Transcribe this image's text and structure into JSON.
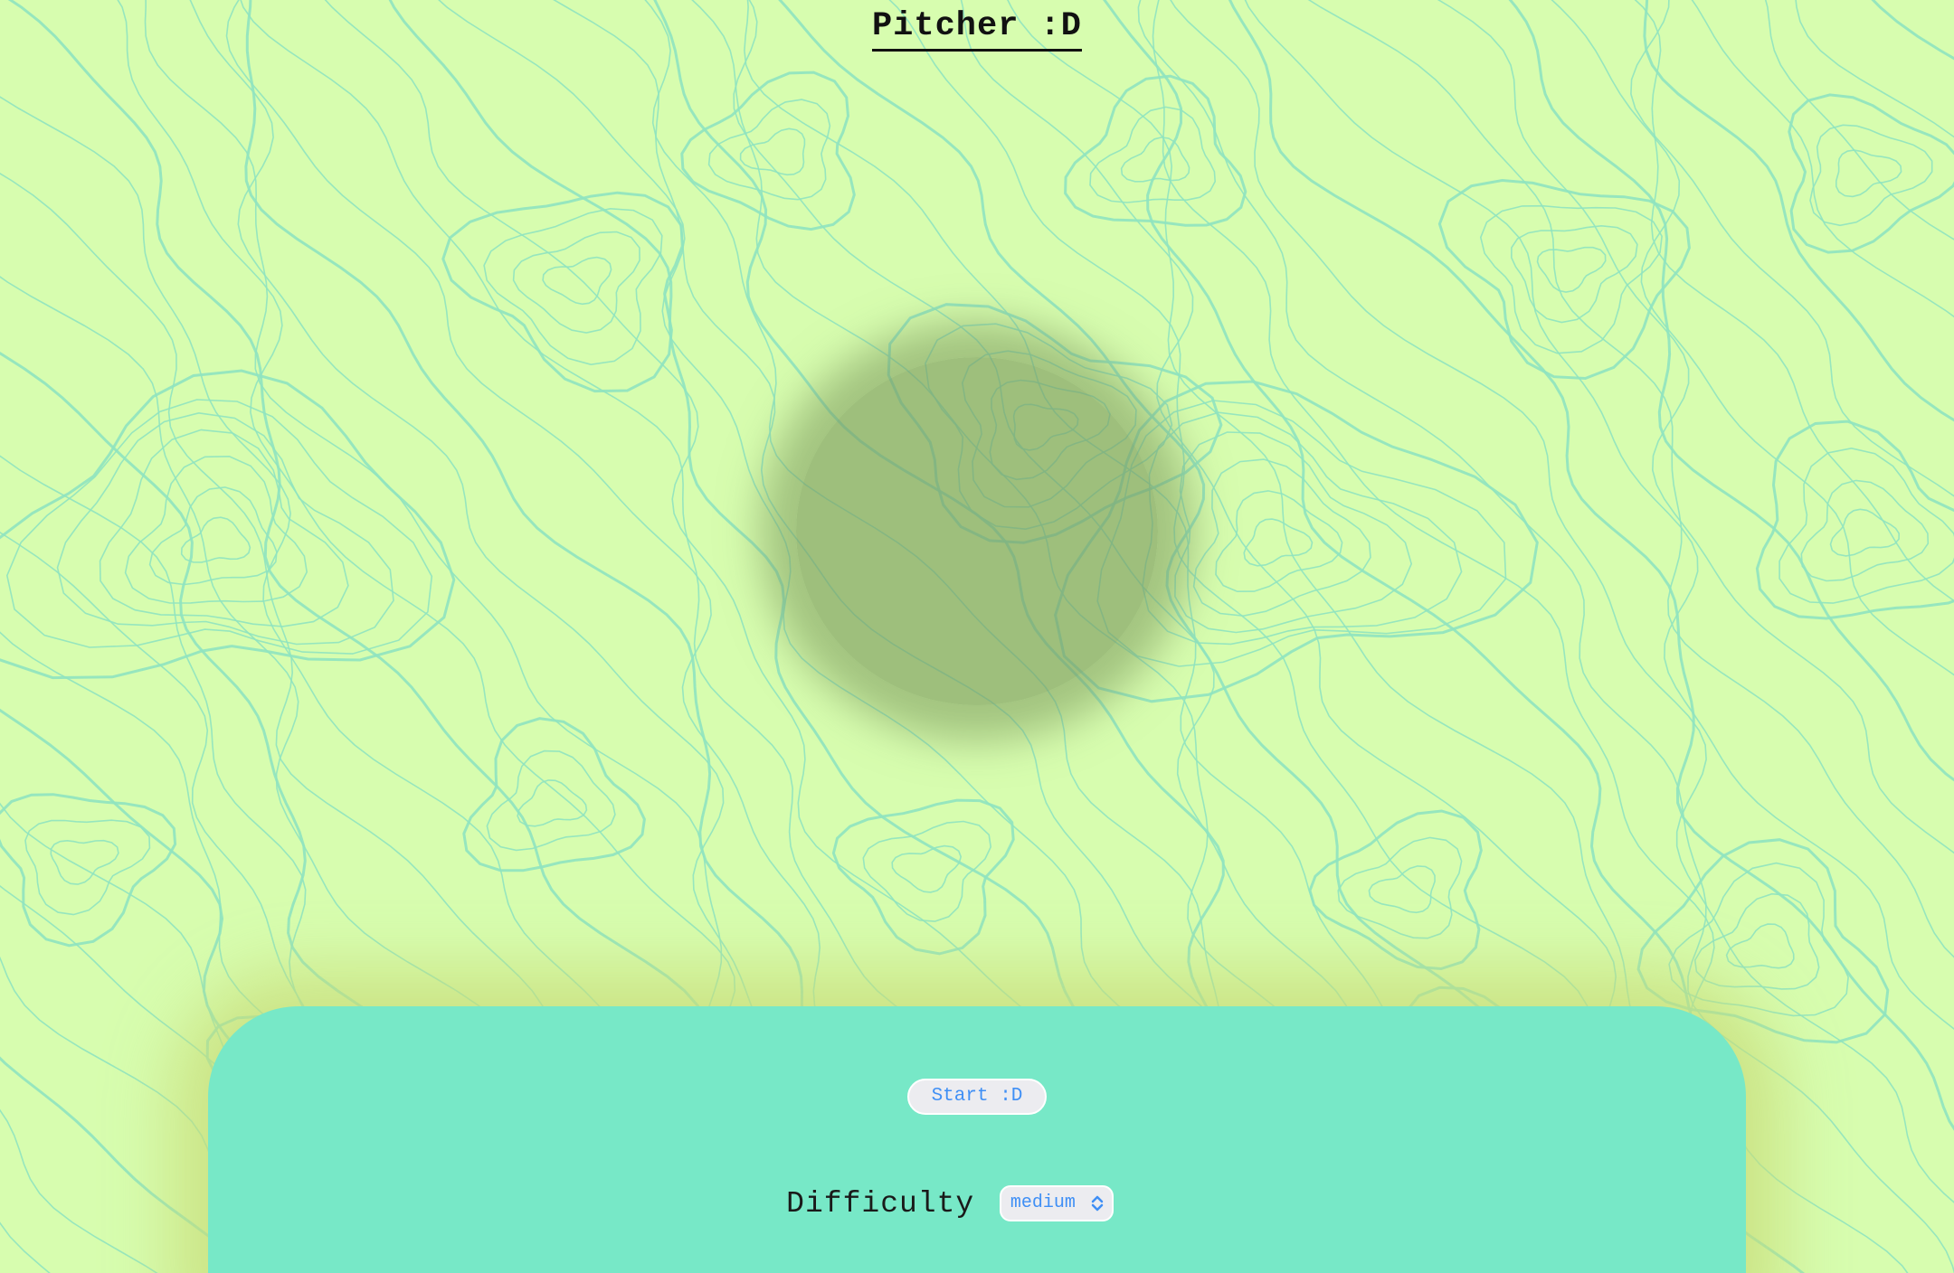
{
  "title": "Pitcher :D",
  "colors": {
    "background": "#d7fdaf",
    "contour": "#8fe3c0",
    "panel": "#77e8c7",
    "button_text": "#3f8ff5",
    "ball": "#7e9658"
  },
  "controls": {
    "start_label": "Start :D",
    "difficulty_label": "Difficulty",
    "difficulty_value": "medium"
  },
  "icons": {
    "select_arrow": "chevron-up-down-icon"
  }
}
